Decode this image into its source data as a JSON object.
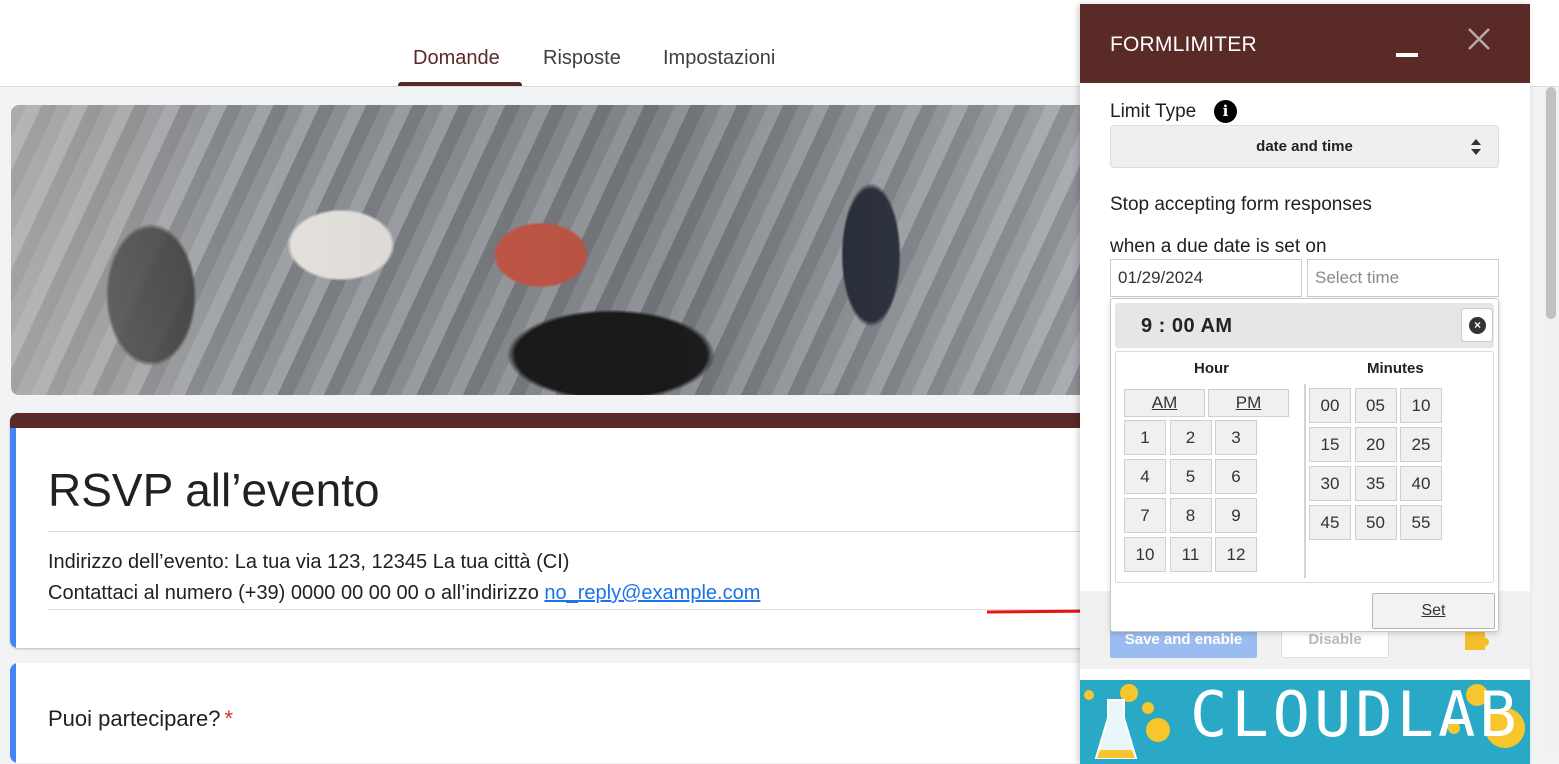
{
  "tabs": [
    {
      "label": "Domande",
      "active": true
    },
    {
      "label": "Risposte",
      "active": false
    },
    {
      "label": "Impostazioni",
      "active": false
    }
  ],
  "form": {
    "title": "RSVP all’evento",
    "address_line": "Indirizzo dell’evento: La tua via 123, 12345 La tua città (CI)",
    "contact_prefix": "Contattaci al numero (+39) 0000 00 00 00 o all’indirizzo ",
    "contact_email": "no_reply@example.com",
    "question": "Puoi partecipare?",
    "required_mark": "*"
  },
  "panel": {
    "title": "FORMLIMITER",
    "limit_type_label": "Limit Type",
    "limit_type_value": "date and time",
    "stop_label": "Stop accepting form responses",
    "due_label": "when a due date is set on",
    "date_value": "01/29/2024",
    "time_placeholder": "Select time",
    "save_label": "Save and enable",
    "disable_label": "Disable",
    "banner_text": "CLOUDLAB"
  },
  "timepicker": {
    "display": "9 : 00 AM",
    "hour_title": "Hour",
    "minutes_title": "Minutes",
    "am": "AM",
    "pm": "PM",
    "hours": [
      "1",
      "2",
      "3",
      "4",
      "5",
      "6",
      "7",
      "8",
      "9",
      "10",
      "11",
      "12"
    ],
    "minutes": [
      "00",
      "05",
      "10",
      "15",
      "20",
      "25",
      "30",
      "35",
      "40",
      "45",
      "50",
      "55"
    ],
    "set_label": "Set"
  },
  "colors": {
    "accent": "#5a2a27",
    "question_band": "#4285f4",
    "annotation_arrow": "#e8130f",
    "banner": "#2aa9c6"
  },
  "icons": [
    "info-icon",
    "minimize-icon",
    "close-icon",
    "select-arrows-icon",
    "clear-time-icon",
    "puzzle-icon"
  ]
}
